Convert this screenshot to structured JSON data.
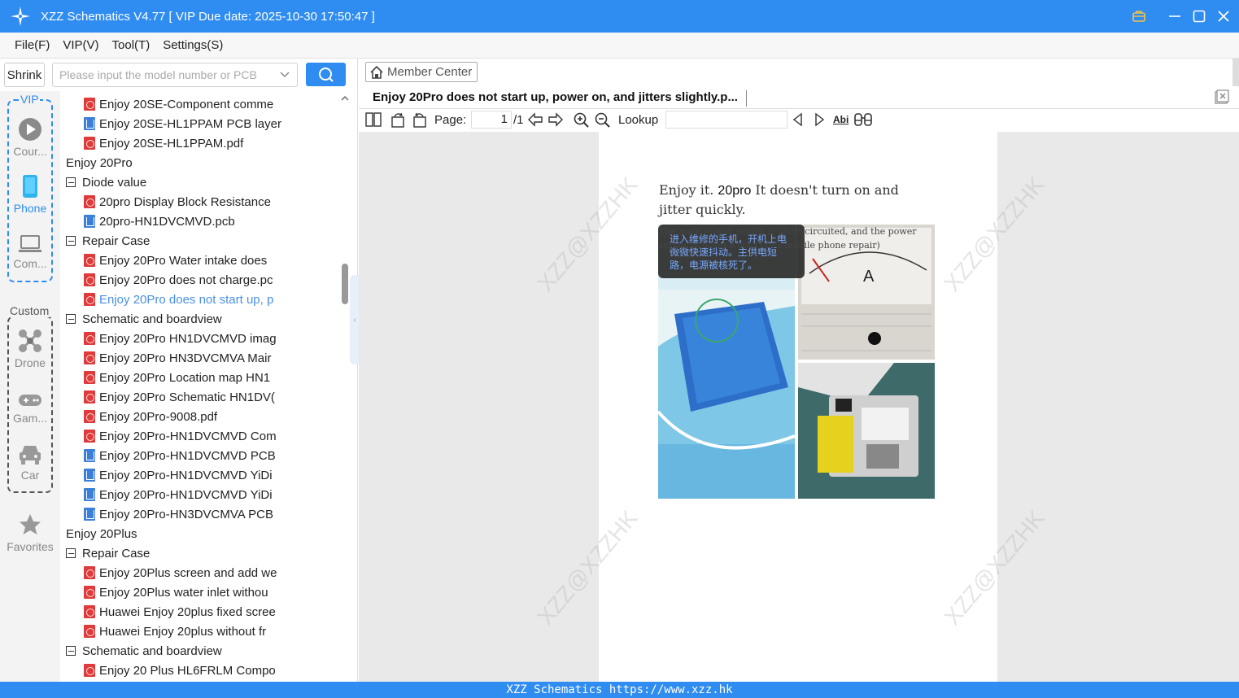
{
  "window": {
    "title": "XZZ Schematics V4.77 [ VIP Due date: 2025-10-30 17:50:47 ]"
  },
  "menu": [
    "File(F)",
    "VIP(V)",
    "Tool(T)",
    "Settings(S)"
  ],
  "search": {
    "shrink_label": "Shrink",
    "placeholder": "Please input the model number or PCB"
  },
  "categories": {
    "vip_label": "VIP",
    "custom_label": "Custom",
    "items": [
      {
        "label": "Cour...",
        "icon": "play-icon"
      },
      {
        "label": "Phone",
        "icon": "phone-icon"
      },
      {
        "label": "Com...",
        "icon": "laptop-icon"
      },
      {
        "label": "Drone",
        "icon": "drone-icon"
      },
      {
        "label": "Gam...",
        "icon": "gamepad-icon"
      },
      {
        "label": "Car",
        "icon": "car-icon"
      },
      {
        "label": "Favorites",
        "icon": "star-icon"
      }
    ]
  },
  "tree": [
    {
      "label": "Enjoy 20SE-Component comme",
      "type": "pdf",
      "level": 2
    },
    {
      "label": "Enjoy 20SE-HL1PPAM PCB layer",
      "type": "pcb",
      "level": 2
    },
    {
      "label": "Enjoy 20SE-HL1PPAM.pdf",
      "type": "pdf",
      "level": 2
    },
    {
      "label": "Enjoy 20Pro",
      "type": "folder",
      "level": 0
    },
    {
      "label": "Diode value",
      "type": "folder",
      "level": 1
    },
    {
      "label": "20pro Display Block Resistance",
      "type": "pdf",
      "level": 2
    },
    {
      "label": "20pro-HN1DVCMVD.pcb",
      "type": "pcb",
      "level": 2
    },
    {
      "label": "Repair Case",
      "type": "folder",
      "level": 1
    },
    {
      "label": "Enjoy 20Pro Water intake does",
      "type": "pdf",
      "level": 2
    },
    {
      "label": "Enjoy 20Pro does not charge.pc",
      "type": "pdf",
      "level": 2
    },
    {
      "label": "Enjoy 20Pro does not start up, p",
      "type": "pdf",
      "level": 2,
      "active": true
    },
    {
      "label": "Schematic and boardview",
      "type": "folder",
      "level": 1
    },
    {
      "label": "Enjoy 20Pro HN1DVCMVD imag",
      "type": "pdf",
      "level": 2
    },
    {
      "label": "Enjoy 20Pro HN3DVCMVA Mair",
      "type": "pdf",
      "level": 2
    },
    {
      "label": "Enjoy 20Pro Location map HN1",
      "type": "pdf",
      "level": 2
    },
    {
      "label": "Enjoy 20Pro Schematic HN1DV(",
      "type": "pdf",
      "level": 2
    },
    {
      "label": "Enjoy 20Pro-9008.pdf",
      "type": "pdf",
      "level": 2
    },
    {
      "label": "Enjoy 20Pro-HN1DVCMVD Com",
      "type": "pdf",
      "level": 2
    },
    {
      "label": "Enjoy 20Pro-HN1DVCMVD PCB",
      "type": "pcb",
      "level": 2
    },
    {
      "label": "Enjoy 20Pro-HN1DVCMVD YiDi",
      "type": "pcb",
      "level": 2
    },
    {
      "label": "Enjoy 20Pro-HN1DVCMVD YiDi",
      "type": "pcb",
      "level": 2
    },
    {
      "label": "Enjoy 20Pro-HN3DVCMVA PCB",
      "type": "pcb",
      "level": 2
    },
    {
      "label": "Enjoy 20Plus",
      "type": "folder",
      "level": 0
    },
    {
      "label": "Repair Case",
      "type": "folder",
      "level": 1
    },
    {
      "label": "Enjoy 20Plus screen and add we",
      "type": "pdf",
      "level": 2
    },
    {
      "label": "Enjoy 20Plus water inlet withou",
      "type": "pdf",
      "level": 2
    },
    {
      "label": "Huawei Enjoy 20plus fixed scree",
      "type": "pdf",
      "level": 2
    },
    {
      "label": "Huawei Enjoy 20plus without fr",
      "type": "pdf",
      "level": 2
    },
    {
      "label": "Schematic and boardview",
      "type": "folder",
      "level": 1
    },
    {
      "label": "Enjoy 20 Plus HL6FRLM Compo",
      "type": "pdf",
      "level": 2
    }
  ],
  "viewer": {
    "member_center": "Member Center",
    "tab_title": "Enjoy 20Pro does not start up, power on, and jitters slightly.p...",
    "page_label": "Page:",
    "page_value": "1",
    "page_total": "/1",
    "lookup_label": "Lookup",
    "doc_line1_a": "Enjoy it. ",
    "doc_line1_b": "20pro",
    "doc_line1_c": " It doesn't turn on and",
    "doc_line2": "jitter quickly.",
    "overlay_cn": "进入维修的手机，开机上电微微快速抖动。主供电短路，电源被核死了。",
    "overlay_en1": "The main power supply is short-circuited, and the power",
    "overlay_en2": "supply is burned out.(Tan's mobile phone repair)",
    "gauge_label": "A",
    "watermark": "XZZ@XZZHK"
  },
  "status": {
    "text": "XZZ Schematics https://www.xzz.hk"
  },
  "colors": {
    "accent": "#2f8cf0",
    "active_item": "#4a90e2",
    "pdf": "#e03a3a",
    "pcb": "#3c7fd8"
  }
}
